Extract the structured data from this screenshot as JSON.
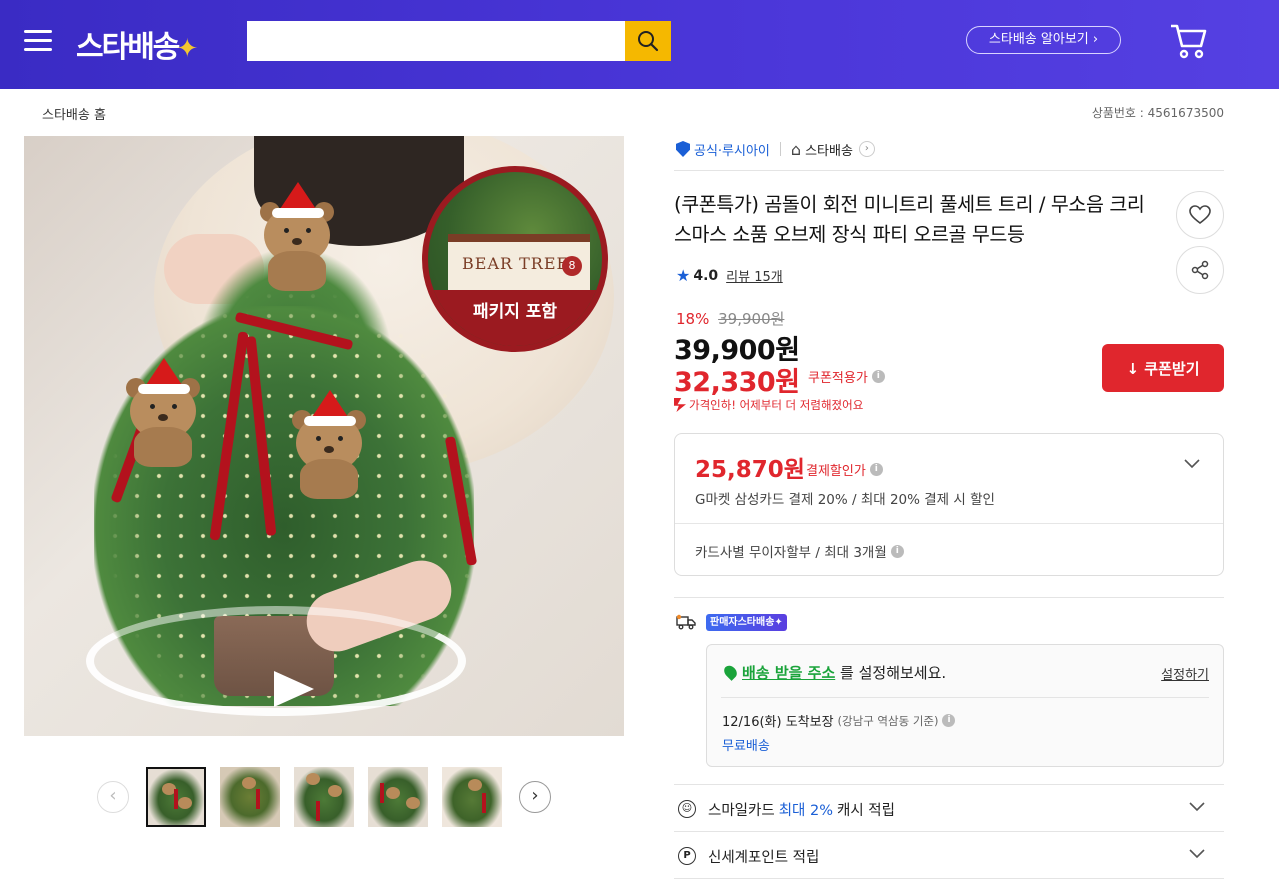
{
  "header": {
    "logo": "스타배송",
    "logo_star": "✦",
    "search_placeholder": "",
    "learn_more": "스타배송 알아보기 ›",
    "menu_icon": "hamburger-menu-icon",
    "search_icon": "search-icon",
    "cart_icon": "cart-icon",
    "gradient_start": "#3a2bc4",
    "gradient_end": "#5540e2"
  },
  "breadcrumb": "스타배송 홈",
  "product_number": "상품번호 : 4561673500",
  "image": {
    "package_label": "패키지 포함",
    "box_text": "BEAR TREE",
    "box_num": "8",
    "thumbnail_count": 5,
    "active_thumbnail": 1
  },
  "seller": {
    "official": "공식·루시아이",
    "store": "스타배송",
    "store_arrow": "›"
  },
  "product": {
    "title": "(쿠폰특가) 곰돌이 회전 미니트리 풀세트 트리 / 무소음 크리스마스 소품 오브제 장식 파티 오르골 무드등",
    "rating": "4.0",
    "reviews": "리뷰 15개",
    "discount_pct": "18%",
    "original_price": "39,900원",
    "price": "39,900원",
    "coupon_price": "32,330원",
    "coupon_label": "쿠폰적용가",
    "price_drop": "가격인하! 어제부터 더 저렴해졌어요",
    "coupon_button": "↓ 쿠폰받기"
  },
  "payment": {
    "price": "25,870원",
    "label": "결제할인가",
    "desc": "G마켓 삼성카드 결제 20% / 최대 20% 결제 시 할인",
    "installment": "카드사별 무이자할부 / 최대 3개월"
  },
  "shipping": {
    "badge": "판매자스타배송✦",
    "addr_link": "배송 받을 주소",
    "addr_suffix": "를 설정해보세요.",
    "set_link": "설정하기",
    "arrival": "12/16(화) 도착보장",
    "arrival_loc": "(강남구 역삼동 기준)",
    "free": "무료배송"
  },
  "benefits": [
    {
      "icon": "☺",
      "prefix": "스마일카드",
      "highlight": "최대 2%",
      "suffix": "캐시 적립"
    },
    {
      "icon": "P",
      "prefix": "신세계포인트 적립",
      "highlight": "",
      "suffix": ""
    }
  ],
  "colors": {
    "accent_red": "#e0262d",
    "accent_blue": "#1a5fd6",
    "accent_green": "#1aa33a",
    "search_yellow": "#f5b800"
  }
}
